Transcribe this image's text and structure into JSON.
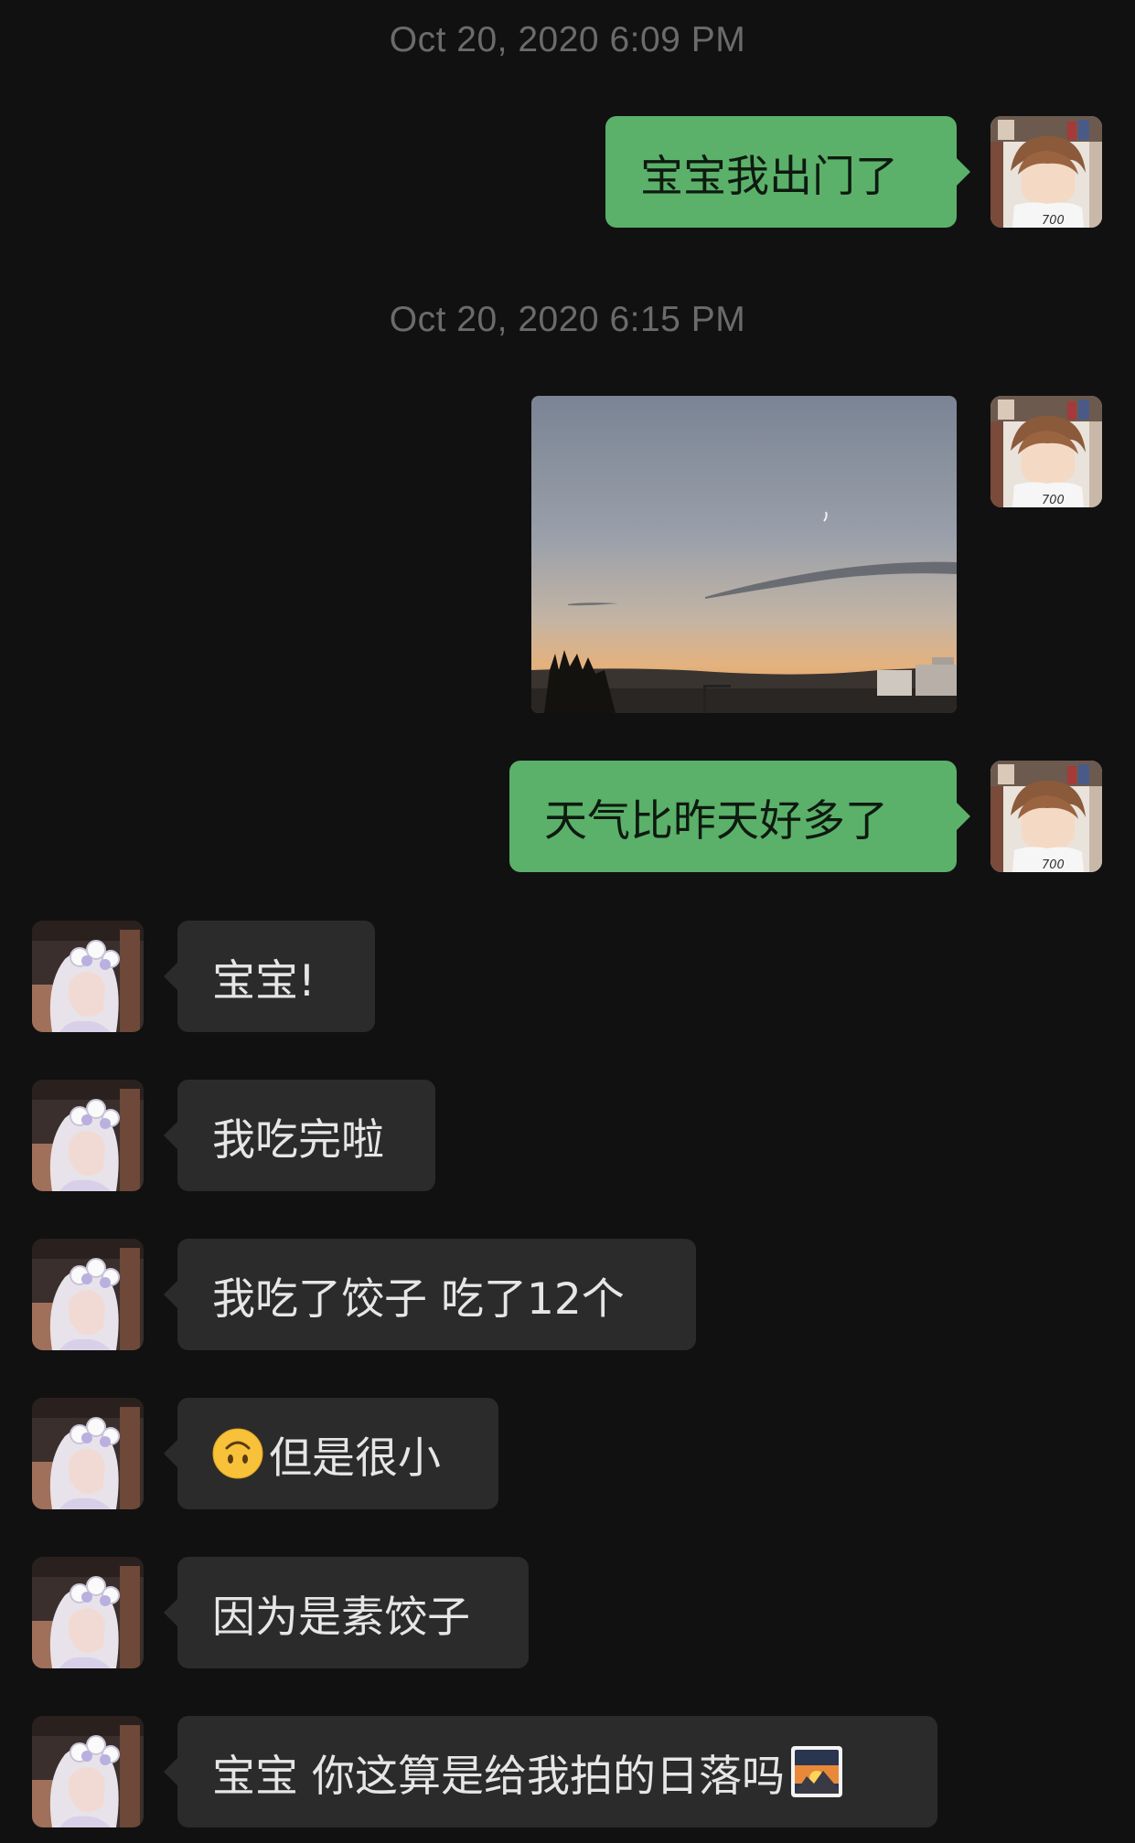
{
  "timestamps": [
    "Oct 20, 2020 6:09 PM",
    "Oct 20, 2020 6:15 PM"
  ],
  "messages": {
    "sent_1": "宝宝我出门了",
    "sent_2": "天气比昨天好多了",
    "recv_1": "宝宝!",
    "recv_2": "我吃完啦",
    "recv_3": "我吃了饺子 吃了12个",
    "recv_4": "但是很小",
    "recv_5": "因为是素饺子",
    "recv_6": "宝宝 你这算是给我拍的日落吗"
  },
  "icons": {
    "recv_4_prefix": "upside-down-face-emoji",
    "recv_6_suffix": "sunrise-over-mountains-emoji",
    "sent_avatar": "anime-boy-avatar",
    "recv_avatar": "anime-girl-avatar"
  },
  "colors": {
    "background": "#111111",
    "sent_bubble": "#5bb16a",
    "received_bubble": "#2b2b2b",
    "timestamp": "#6b6b6b"
  }
}
